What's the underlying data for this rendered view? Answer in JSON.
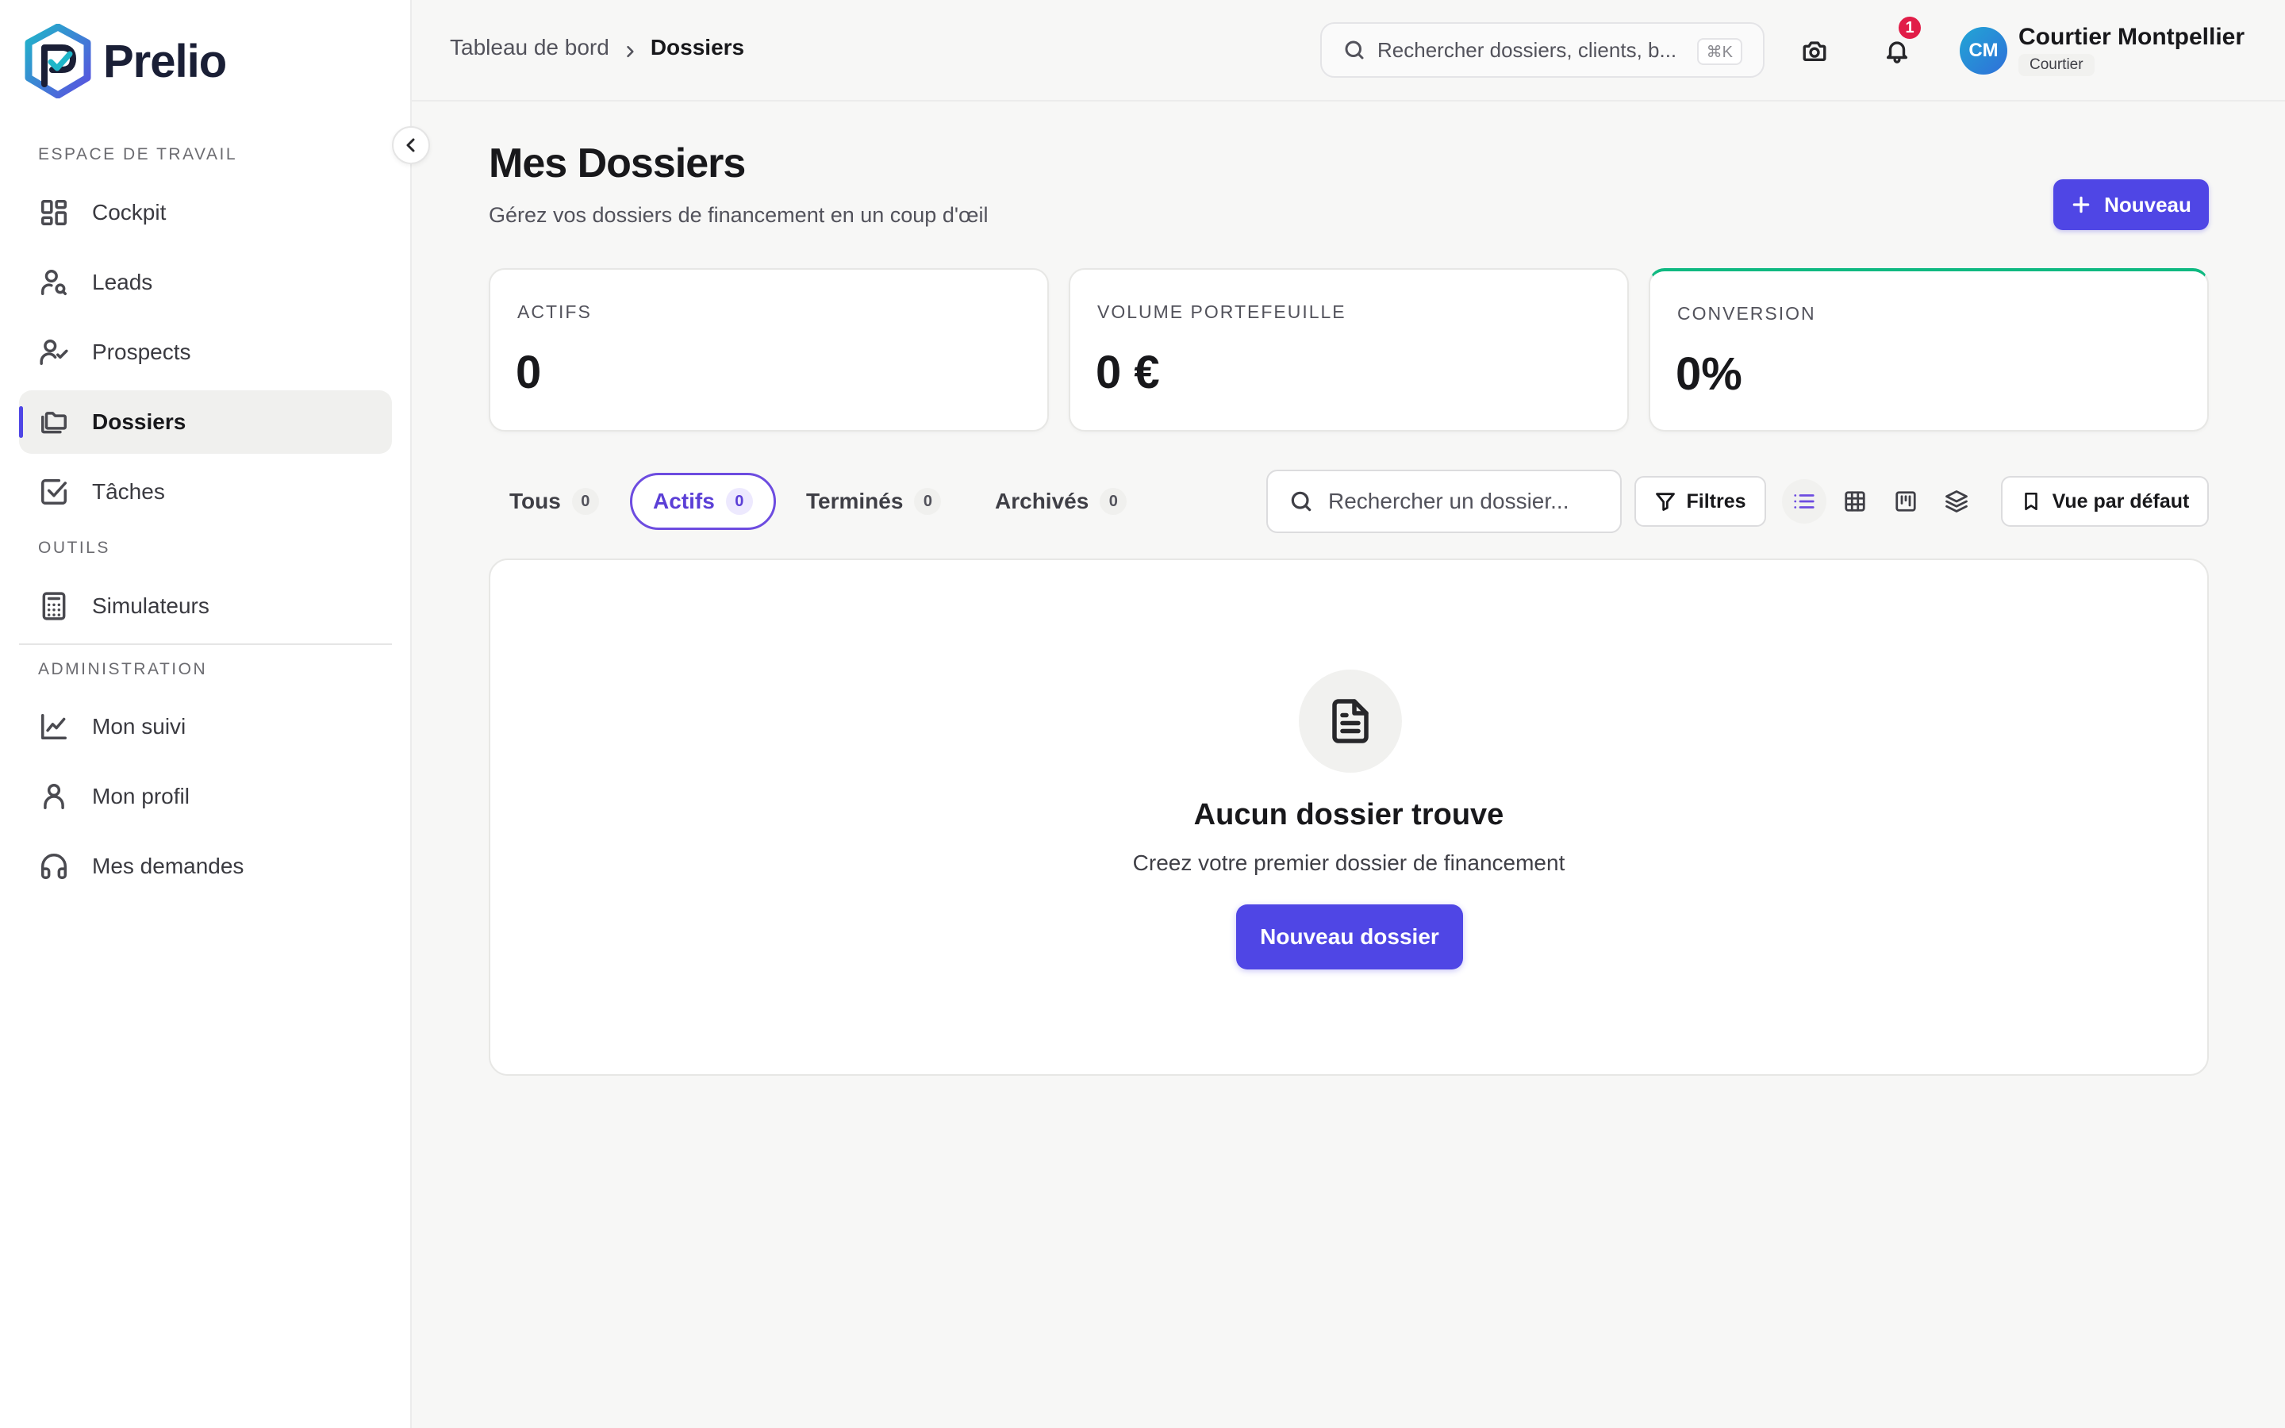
{
  "brand": {
    "name": "Prelio",
    "accent": "#4f46e5"
  },
  "sidebar": {
    "sections": {
      "workspace": "ESPACE DE TRAVAIL",
      "tools": "OUTILS",
      "admin": "ADMINISTRATION"
    },
    "items": [
      {
        "label": "Cockpit",
        "icon": "dashboard-icon"
      },
      {
        "label": "Leads",
        "icon": "user-search-icon"
      },
      {
        "label": "Prospects",
        "icon": "user-check-icon"
      },
      {
        "label": "Dossiers",
        "icon": "folders-icon",
        "active": true
      },
      {
        "label": "Tâches",
        "icon": "checkbox-icon"
      },
      {
        "label": "Simulateurs",
        "icon": "calculator-icon"
      },
      {
        "label": "Mon suivi",
        "icon": "line-chart-icon"
      },
      {
        "label": "Mon profil",
        "icon": "user-icon"
      },
      {
        "label": "Mes demandes",
        "icon": "headphones-icon"
      }
    ]
  },
  "header": {
    "breadcrumb": [
      "Tableau de bord",
      "Dossiers"
    ],
    "search": {
      "placeholder": "Rechercher dossiers, clients, b...",
      "shortcut": "⌘K"
    },
    "notifications": {
      "count": "1"
    },
    "user": {
      "initials": "CM",
      "name": "Courtier Montpellier",
      "role": "Courtier"
    }
  },
  "main": {
    "title": "Mes Dossiers",
    "subtitle": "Gérez vos dossiers de financement en un coup d'œil",
    "new_button": "Nouveau",
    "stats": [
      {
        "label": "ACTIFS",
        "value": "0"
      },
      {
        "label": "VOLUME PORTEFEUILLE",
        "value": "0 €"
      },
      {
        "label": "CONVERSION",
        "value": "0%"
      }
    ],
    "tabs": [
      {
        "label": "Tous",
        "count": "0"
      },
      {
        "label": "Actifs",
        "count": "0",
        "active": true
      },
      {
        "label": "Terminés",
        "count": "0"
      },
      {
        "label": "Archivés",
        "count": "0"
      }
    ],
    "list_search_placeholder": "Rechercher un dossier...",
    "filters_button": "Filtres",
    "view_modes": [
      "list-view-icon",
      "table-view-icon",
      "kanban-view-icon",
      "layers-view-icon"
    ],
    "default_view_button": "Vue par défaut",
    "empty_state": {
      "title": "Aucun dossier trouve",
      "subtitle": "Creez votre premier dossier de financement",
      "button": "Nouveau dossier"
    }
  },
  "colors": {
    "primary": "#4f46e5",
    "active_tab": "#6d4ce0",
    "badge": "#e11d48",
    "success": "#10b981"
  }
}
